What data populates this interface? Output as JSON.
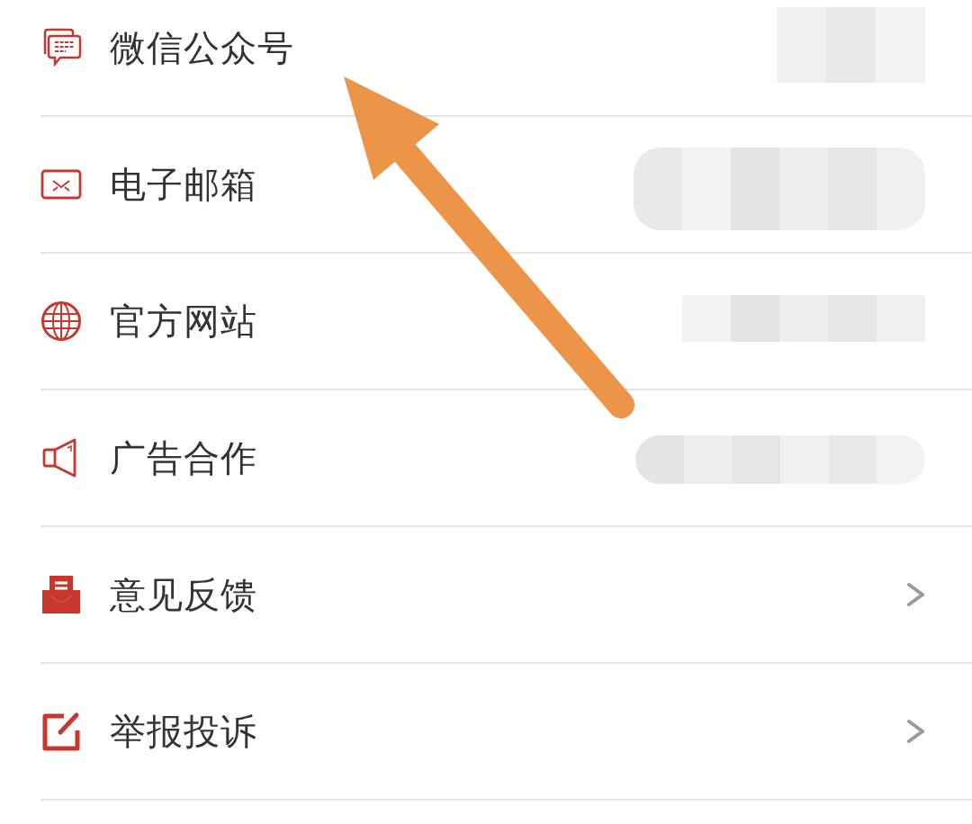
{
  "menu": [
    {
      "label": "微信公众号",
      "kind": "blurred"
    },
    {
      "label": "电子邮箱",
      "kind": "blurred"
    },
    {
      "label": "官方网站",
      "kind": "blurred"
    },
    {
      "label": "广告合作",
      "kind": "blurred"
    },
    {
      "label": "意见反馈",
      "kind": "chevron"
    },
    {
      "label": "举报投诉",
      "kind": "chevron"
    }
  ],
  "annotations": [
    {
      "kind": "arrow"
    }
  ]
}
